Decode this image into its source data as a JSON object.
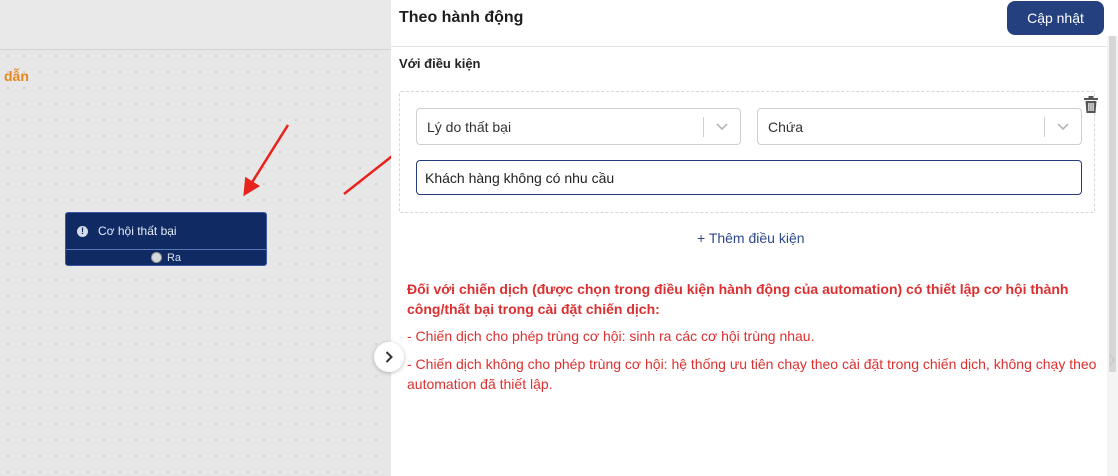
{
  "canvas": {
    "guide_text": "dẫn",
    "node": {
      "title": "Cơ hội thất bại",
      "output_label": "Ra"
    }
  },
  "panel": {
    "title": "Theo hành động",
    "update_button": "Cập nhật",
    "condition_label": "Với điều kiện",
    "condition": {
      "field": "Lý do thất bại",
      "operator": "Chứa",
      "value": "Khách hàng không có nhu cầu"
    },
    "add_condition": "+ Thêm điều kiện",
    "note": {
      "heading": "Đối với chiến dịch (được chọn trong điều kiện hành động của automation) có thiết lập cơ hội thành công/thất bại trong cài đặt chiến dịch:",
      "item1": "- Chiến dịch cho phép trùng cơ hội: sinh ra các cơ hội trùng nhau.",
      "item2": "- Chiến dịch không cho phép trùng cơ hội: hệ thống ưu tiên chạy theo cài đặt trong chiến dịch, không chạy theo automation đã thiết lập."
    }
  },
  "icons": {
    "trash": "trash-icon",
    "chevron": "chevron-down-icon",
    "collapse": "chevron-right-icon",
    "alert": "alert-circle-icon"
  },
  "colors": {
    "primary": "#24407f",
    "node_bg": "#102b63",
    "warning_text": "#dc2f2f",
    "guide_orange": "#e3861c",
    "annotation_red": "#e8221c"
  }
}
